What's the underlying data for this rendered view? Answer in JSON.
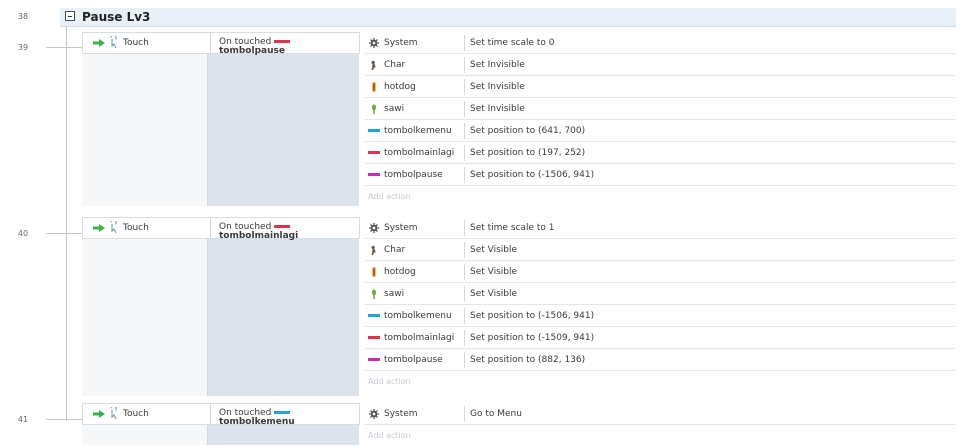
{
  "colors": {
    "header_bg": "#e9f0f7",
    "trigger_bg": "#dde3ea",
    "gear": "#555555",
    "char": "#6b5a45",
    "hotdog": "#e0a020",
    "sawi": "#6bb13a",
    "menu_bar": "#23a5d8",
    "mainlagi_bar": "#e0304a",
    "pause_bar": "#c52fb0",
    "arrow": "#38b34a"
  },
  "group": {
    "line_number": "38",
    "title": "Pause Lv3"
  },
  "events": [
    {
      "line_number": "39",
      "trigger_label": "Touch",
      "condition_text": "On touched",
      "condition_object": "tombolpause",
      "condition_icon": "mainlagi-bar-icon",
      "actions": [
        {
          "object": "System",
          "icon": "gear-icon",
          "text": "Set time scale to 0"
        },
        {
          "object": "Char",
          "icon": "char-icon",
          "text": "Set Invisible"
        },
        {
          "object": "hotdog",
          "icon": "hotdog-icon",
          "text": "Set Invisible"
        },
        {
          "object": "sawi",
          "icon": "sawi-icon",
          "text": "Set Invisible"
        },
        {
          "object": "tombolkemenu",
          "icon": "menu-bar-icon",
          "text": "Set position to (641, 700)"
        },
        {
          "object": "tombolmainlagi",
          "icon": "mainlagi-bar-icon",
          "text": "Set position to (197, 252)"
        },
        {
          "object": "tombolpause",
          "icon": "pause-bar-icon",
          "text": "Set position to (-1506, 941)"
        }
      ],
      "add_action": "Add action"
    },
    {
      "line_number": "40",
      "trigger_label": "Touch",
      "condition_text": "On touched",
      "condition_object": "tombolmainlagi",
      "condition_icon": "mainlagi-bar-icon",
      "actions": [
        {
          "object": "System",
          "icon": "gear-icon",
          "text": "Set time scale to 1"
        },
        {
          "object": "Char",
          "icon": "char-icon",
          "text": "Set Visible"
        },
        {
          "object": "hotdog",
          "icon": "hotdog-icon",
          "text": "Set Visible"
        },
        {
          "object": "sawi",
          "icon": "sawi-icon",
          "text": "Set Visible"
        },
        {
          "object": "tombolkemenu",
          "icon": "menu-bar-icon",
          "text": "Set position to (-1506, 941)"
        },
        {
          "object": "tombolmainlagi",
          "icon": "mainlagi-bar-icon",
          "text": "Set position to (-1509, 941)"
        },
        {
          "object": "tombolpause",
          "icon": "pause-bar-icon",
          "text": "Set position to (882, 136)"
        }
      ],
      "add_action": "Add action"
    },
    {
      "line_number": "41",
      "trigger_label": "Touch",
      "condition_text": "On touched",
      "condition_object": "tombolkemenu",
      "condition_icon": "menu-bar-icon",
      "actions": [
        {
          "object": "System",
          "icon": "gear-icon",
          "text": "Go to Menu"
        }
      ],
      "add_action": "Add action"
    }
  ]
}
